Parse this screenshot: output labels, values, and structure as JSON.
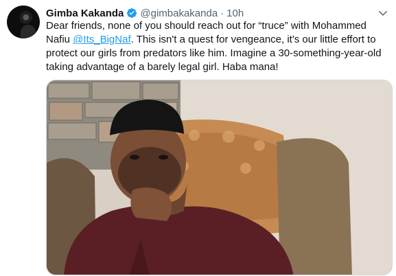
{
  "tweet": {
    "display_name": "Gimba Kakanda",
    "handle": "@gimbakakanda",
    "separator": "·",
    "time": "10h",
    "text_before_mention": "Dear friends, none of you should reach out for “truce” with Mohammed Nafiu ",
    "mention": "@Its_BigNaf",
    "text_after_mention": ". This isn't a quest for vengeance, it's our little effort to protect our girls from predators like him. Imagine a 30-something-year-old taking advantage of a barely legal girl. Haba mana!"
  },
  "icons": {
    "verified": "verified-badge-icon",
    "caret": "chevron-down-icon"
  },
  "colors": {
    "link": "#1d9bf0",
    "verified": "#1d9bf0",
    "secondary_text": "#536471"
  }
}
